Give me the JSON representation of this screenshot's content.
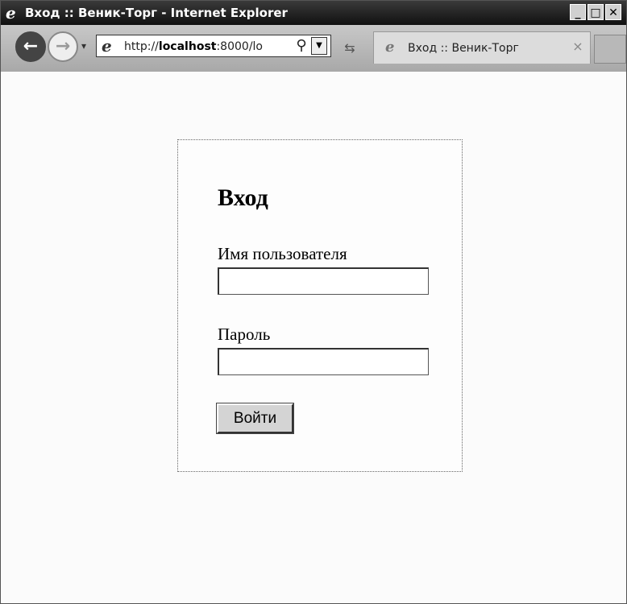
{
  "window": {
    "title": "Вход :: Веник-Торг - Internet Explorer",
    "title_icon": "ie-icon",
    "controls": {
      "minimize": "_",
      "maximize": "□",
      "close": "✕"
    }
  },
  "toolbar": {
    "url_prefix": "http://",
    "url_host": "localhost",
    "url_rest": ":8000/lo",
    "tab_title": "Вход :: Веник-Торг",
    "tab_close": "×",
    "icons": [
      "back-icon",
      "forward-icon",
      "ie-icon",
      "search-icon",
      "dropdown-icon",
      "refresh-icon"
    ]
  },
  "login": {
    "title": "Вход",
    "username_label": "Имя пользователя",
    "username_value": "",
    "password_label": "Пароль",
    "password_value": "",
    "submit_label": "Войти"
  }
}
